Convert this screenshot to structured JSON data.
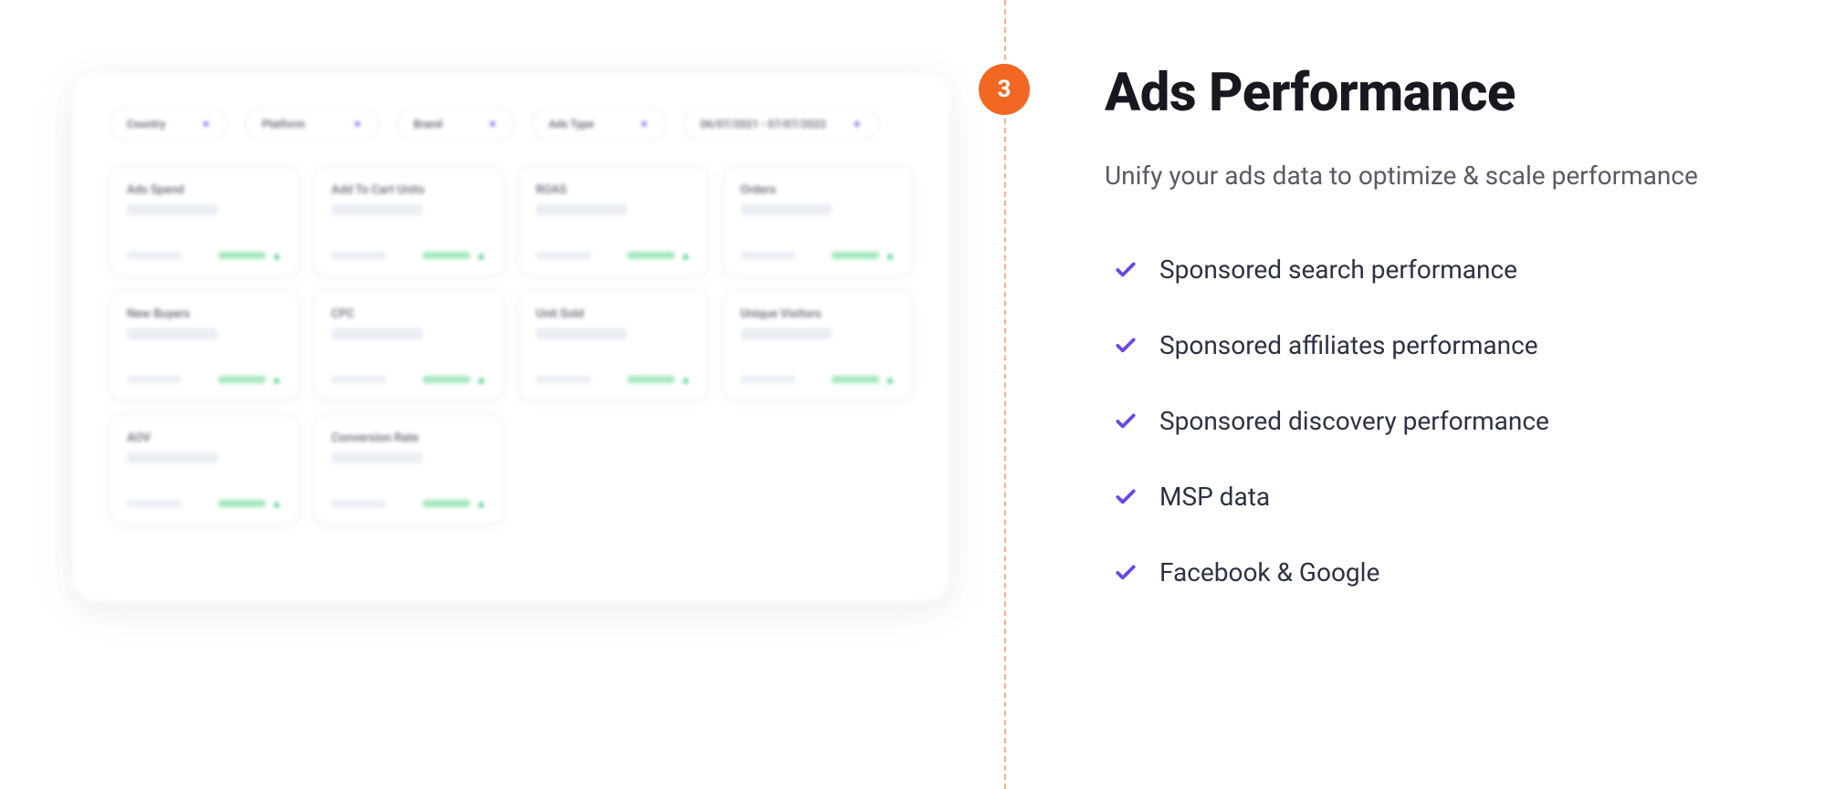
{
  "step_number": "3",
  "headline": "Ads Performance",
  "subhead": "Unify your ads data to optimize & scale performance",
  "features": [
    "Sponsored search performance",
    "Sponsored affiliates performance",
    "Sponsored discovery performance",
    "MSP data",
    "Facebook & Google"
  ],
  "dashboard": {
    "filters": {
      "country": "Country",
      "platform": "Platform",
      "brand": "Brand",
      "ads_type": "Ads Type",
      "date_range": "06/07/2021 - 07/07/2022"
    },
    "metrics": [
      "Ads Spend",
      "Add To Cart Units",
      "ROAS",
      "Orders",
      "New Buyers",
      "CPC",
      "Unit Sold",
      "Unique Visitors",
      "AOV",
      "Conversion Rate"
    ]
  }
}
